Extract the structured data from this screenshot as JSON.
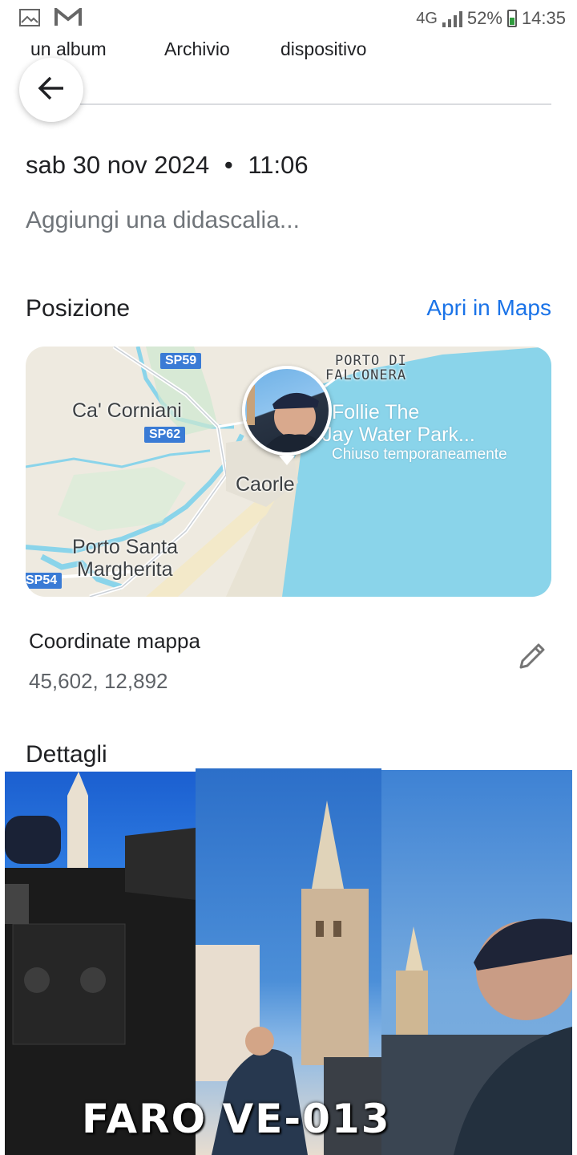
{
  "status_bar": {
    "left_icons": [
      "gallery-icon",
      "gmail-icon"
    ],
    "network": "4G",
    "battery": "52%",
    "time": "14:35"
  },
  "tabs": [
    "un album",
    "Archivio",
    "dispositivo"
  ],
  "photo_info": {
    "date": "sab 30 nov 2024",
    "separator": "•",
    "time": "11:06",
    "caption_placeholder": "Aggiungi una didascalia..."
  },
  "position": {
    "title": "Posizione",
    "maps_link": "Apri in Maps",
    "map_labels": {
      "porto_di": "PORTO DI",
      "falconera": "FALCONERA",
      "ca_corniani": "Ca' Corniani",
      "sp59": "SP59",
      "sp62": "SP62",
      "sp54": "SP54",
      "poi_1": "Follie The",
      "poi_2": "Jay Water Park...",
      "poi_3": "Chiuso temporaneamente",
      "caorle": "Caorle",
      "porto_santa": "Porto Santa",
      "margherita": "Margherita"
    }
  },
  "coordinates": {
    "title": "Coordinate mappa",
    "value": "45,602, 12,892"
  },
  "details": {
    "title": "Dettagli"
  },
  "collage": {
    "title": "FARO VE-013"
  },
  "icons": {
    "back": "arrow-left-icon",
    "edit": "pencil-icon"
  }
}
